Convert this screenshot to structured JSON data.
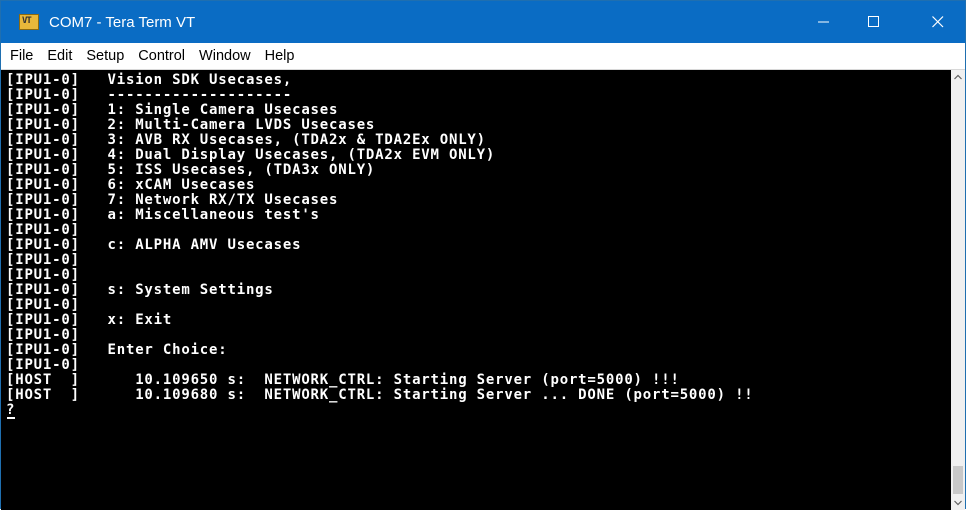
{
  "window": {
    "icon_text": "VT",
    "title": "COM7 - Tera Term VT",
    "titlebar_color": "#0a6cc4"
  },
  "controls": {
    "minimize_icon": "minimize-icon",
    "maximize_icon": "maximize-icon",
    "close_icon": "close-icon"
  },
  "menu": {
    "items": [
      "File",
      "Edit",
      "Setup",
      "Control",
      "Window",
      "Help"
    ]
  },
  "terminal": {
    "background": "#000000",
    "foreground": "#ffffff",
    "lines": [
      "[IPU1-0]   Vision SDK Usecases,",
      "[IPU1-0]   --------------------",
      "[IPU1-0]   1: Single Camera Usecases",
      "[IPU1-0]   2: Multi-Camera LVDS Usecases",
      "[IPU1-0]   3: AVB RX Usecases, (TDA2x & TDA2Ex ONLY)",
      "[IPU1-0]   4: Dual Display Usecases, (TDA2x EVM ONLY)",
      "[IPU1-0]   5: ISS Usecases, (TDA3x ONLY)",
      "[IPU1-0]   6: xCAM Usecases",
      "[IPU1-0]   7: Network RX/TX Usecases",
      "[IPU1-0]   a: Miscellaneous test's",
      "[IPU1-0]",
      "[IPU1-0]   c: ALPHA AMV Usecases",
      "[IPU1-0]",
      "[IPU1-0]",
      "[IPU1-0]   s: System Settings",
      "[IPU1-0]",
      "[IPU1-0]   x: Exit",
      "[IPU1-0]",
      "[IPU1-0]   Enter Choice:",
      "[IPU1-0]",
      "[HOST  ]      10.109650 s:  NETWORK_CTRL: Starting Server (port=5000) !!!",
      "[HOST  ]      10.109680 s:  NETWORK_CTRL: Starting Server ... DONE (port=5000) !!",
      "?"
    ]
  }
}
